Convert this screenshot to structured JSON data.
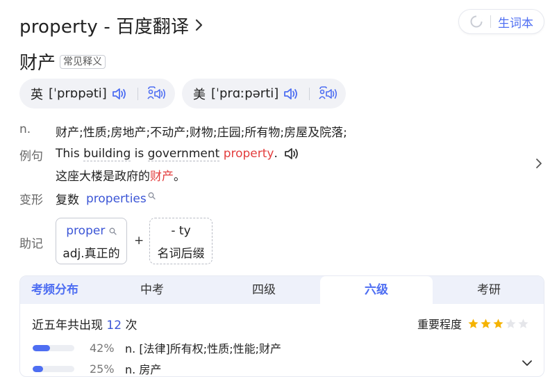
{
  "header": {
    "title": "property - 百度翻译",
    "vocab_button": "生词本"
  },
  "word": {
    "headword": "财产",
    "tag": "常见释义"
  },
  "phonetics": [
    {
      "region": "英",
      "ipa": "[ˈprɒpəti]"
    },
    {
      "region": "美",
      "ipa": "[ˈprɑːpərti]"
    }
  ],
  "definition": {
    "pos": "n.",
    "meanings": "财产;性质;房地产;不动产;财物;庄园;所有物;房屋及院落;"
  },
  "example": {
    "label": "例句",
    "en_before": "This ",
    "en_dotted_1": "building",
    "en_mid_1": " is ",
    "en_dotted_2": "government",
    "en_mid_2": " ",
    "en_highlight": "property",
    "en_after": ".",
    "zh_before": "这座大楼是政府的",
    "zh_highlight": "财产",
    "zh_after": "。"
  },
  "variant": {
    "label": "变形",
    "type": "复数",
    "form": "properties"
  },
  "mnemonic": {
    "label": "助记",
    "part1_word": "proper",
    "part1_meaning": "adj.真正的",
    "plus": "+",
    "part2_word": "- ty",
    "part2_meaning": "名词后缀"
  },
  "frequency": {
    "tabs": [
      "考频分布",
      "中考",
      "四级",
      "六级",
      "考研"
    ],
    "active_tab": "六级",
    "stats_prefix": "近五年共出现",
    "stats_count": "12",
    "stats_suffix": "次",
    "importance_label": "重要程度",
    "importance_stars": 3,
    "importance_max": 5,
    "rows": [
      {
        "percent": "42%",
        "fraction": 0.42,
        "definition": "n. [法律]所有权;性质;性能;财产"
      },
      {
        "percent": "25%",
        "fraction": 0.25,
        "definition": "n. 房产"
      }
    ]
  },
  "colors": {
    "accent": "#4e6ef2",
    "highlight": "#e33d3d",
    "star": "#f5b301",
    "star_empty": "#e5e6ea"
  }
}
